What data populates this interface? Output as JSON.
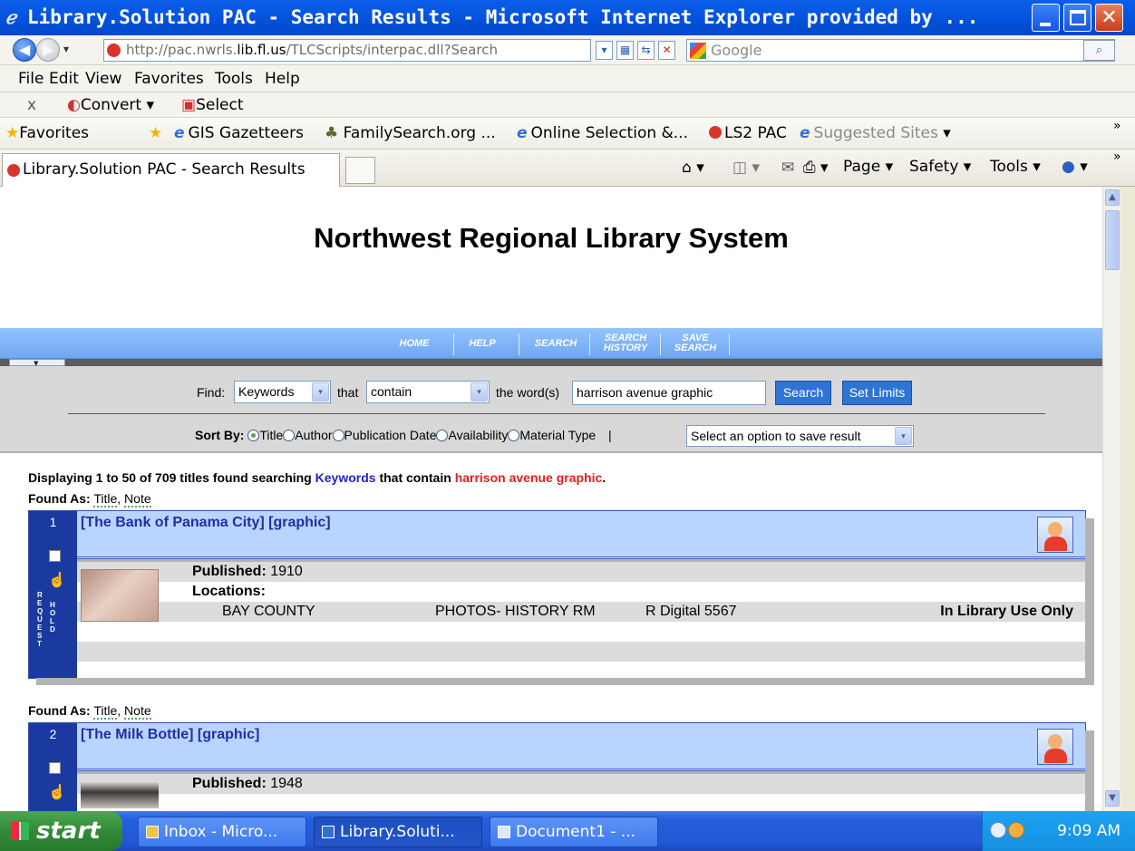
{
  "window": {
    "title": "Library.Solution PAC - Search Results - Microsoft Internet Explorer provided by ...",
    "icon": "ie-icon",
    "minimize_icon": "minimize-icon",
    "maximize_icon": "maximize-icon",
    "close_icon": "close-icon",
    "close_glyph": "✕"
  },
  "address_bar": {
    "url_prefix": "http://pac.nwrls.",
    "url_host_bold": "lib.fl.us",
    "url_suffix": "/TLCScripts/interpac.dll?Search",
    "search_placeholder": "Google",
    "back_glyph": "◀",
    "forward_glyph": "▶",
    "dropdown_glyph": "▾",
    "search_glyph": "⌕"
  },
  "menu": {
    "items": [
      "File",
      "Edit",
      "View",
      "Favorites",
      "Tools",
      "Help"
    ]
  },
  "command_bar": {
    "close_glyph": "x",
    "convert_label": "Convert",
    "select_label": "Select"
  },
  "favorites_bar": {
    "favorites_label": "Favorites",
    "gis_label": "GIS Gazetteers",
    "familysearch_label": "FamilySearch.org ...",
    "online_label": "Online Selection &...",
    "ls2_label": "LS2 PAC",
    "suggested_label": "Suggested Sites",
    "overflow": "»"
  },
  "tab_bar": {
    "active_tab": "Library.Solution PAC - Search Results",
    "page_label": "Page",
    "safety_label": "Safety",
    "tools_label": "Tools",
    "overflow": "»"
  },
  "page": {
    "site_title": "Northwest Regional Library System",
    "nav": [
      {
        "line1": "HOME",
        "line2": ""
      },
      {
        "line1": "HELP",
        "line2": ""
      },
      {
        "line1": "SEARCH",
        "line2": ""
      },
      {
        "line1": "SEARCH",
        "line2": "HISTORY"
      },
      {
        "line1": "SAVE",
        "line2": "SEARCH"
      }
    ],
    "find": {
      "find_label": "Find:",
      "field_value": "Keywords",
      "that_label": "that",
      "operator_value": "contain",
      "words_label": "the word(s)",
      "query_value": "harrison avenue graphic",
      "search_button": "Search",
      "limits_button": "Set Limits",
      "dropdown_glyph": "▾"
    },
    "sort": {
      "label": "Sort By:",
      "options": [
        "Title",
        "Author",
        "Publication Date",
        "Availability",
        "Material Type"
      ],
      "selected": "Title",
      "pipe": "|",
      "save_select": "Select an option to save result"
    },
    "results_summary": {
      "prefix": "Displaying 1 to 50 of 709 titles found searching ",
      "field": "Keywords",
      "middle": " that contain ",
      "query": "harrison avenue graphic",
      "suffix": ".",
      "field_color": "#2222cc",
      "query_color": "#e02020"
    },
    "found_as_label": "Found As:",
    "found_as_values": [
      "Title",
      "Note"
    ],
    "records": [
      {
        "number": "1",
        "title": "[The Bank of Panama City] [graphic]",
        "published_label": "Published:",
        "published": "1910",
        "locations_label": "Locations:",
        "location": "BAY COUNTY",
        "collection": "PHOTOS- HISTORY RM",
        "call_number": "R Digital 5567",
        "status": "In Library Use Only"
      },
      {
        "number": "2",
        "title": "[The Milk Bottle] [graphic]",
        "published_label": "Published:",
        "published": "1948"
      }
    ],
    "request_hold_letters": {
      "request": [
        "R",
        "E",
        "Q",
        "U",
        "E",
        "S",
        "T"
      ],
      "hold": [
        "H",
        "O",
        "L",
        "D"
      ]
    }
  },
  "taskbar": {
    "start_label": "start",
    "tasks": [
      {
        "label": "Inbox - Micro...",
        "active": false
      },
      {
        "label": "Library.Soluti...",
        "active": true
      },
      {
        "label": "Document1 - ...",
        "active": false
      }
    ],
    "clock": "9:09 AM"
  },
  "colors": {
    "titlebar_blue": "#0554e0",
    "nav_blue": "#6ea8ef",
    "record_head": "#b9d5ff",
    "record_left": "#1a3a9f",
    "link_blue": "#1f2fa3"
  }
}
